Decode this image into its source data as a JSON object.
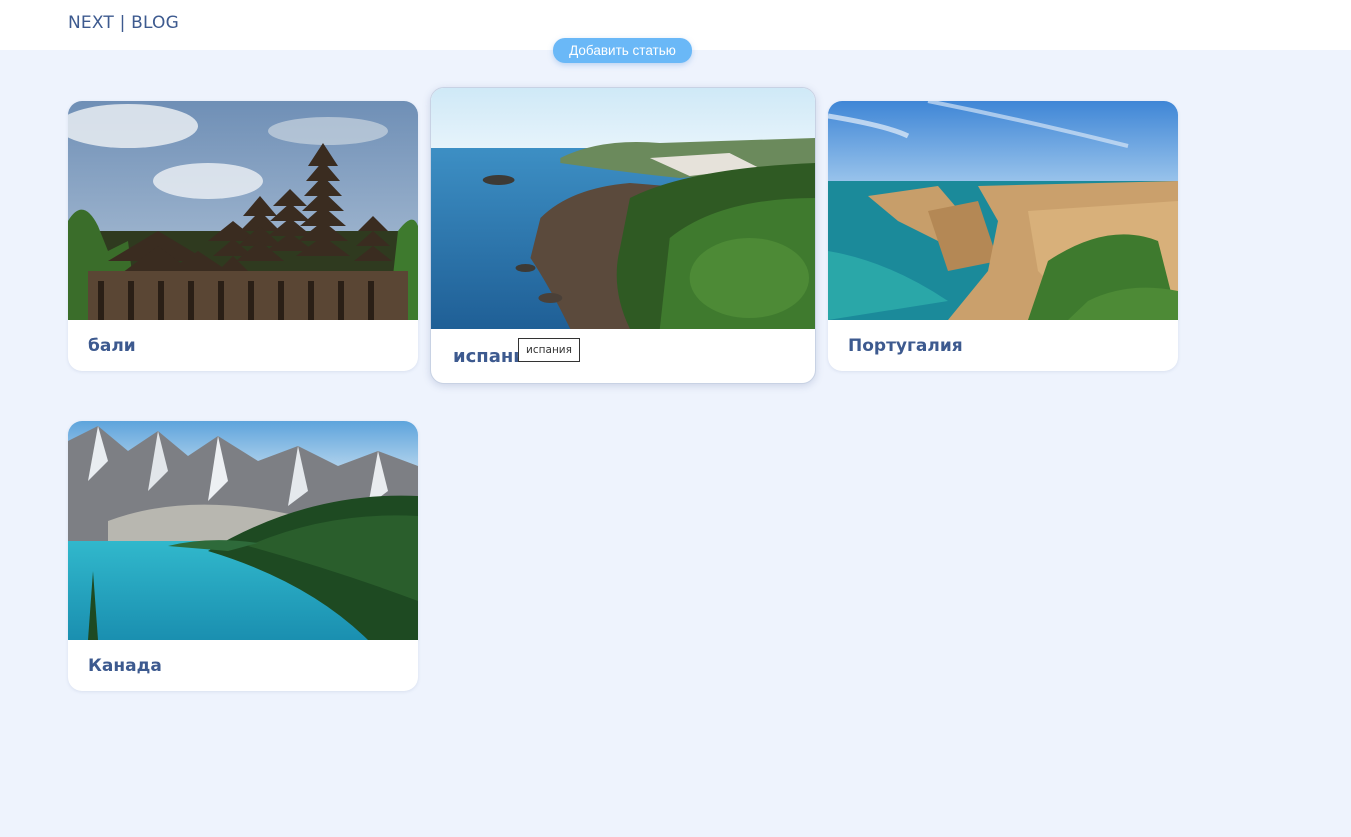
{
  "header": {
    "logo": "NEXT | BLOG",
    "add_article_button": "Добавить статью"
  },
  "colors": {
    "background": "#eef3fd",
    "header": "#ffffff",
    "title_text": "#3d5a8f",
    "button": "#6ab8f7"
  },
  "posts": [
    {
      "title": "бали",
      "image": "bali-temples-photo"
    },
    {
      "title": "испания",
      "image": "spain-coast-photo"
    },
    {
      "title": "Португалия",
      "image": "portugal-cliffs-photo"
    },
    {
      "title": "Канада",
      "image": "canada-mountain-lake-photo"
    }
  ],
  "tooltip": {
    "text": "испания"
  }
}
